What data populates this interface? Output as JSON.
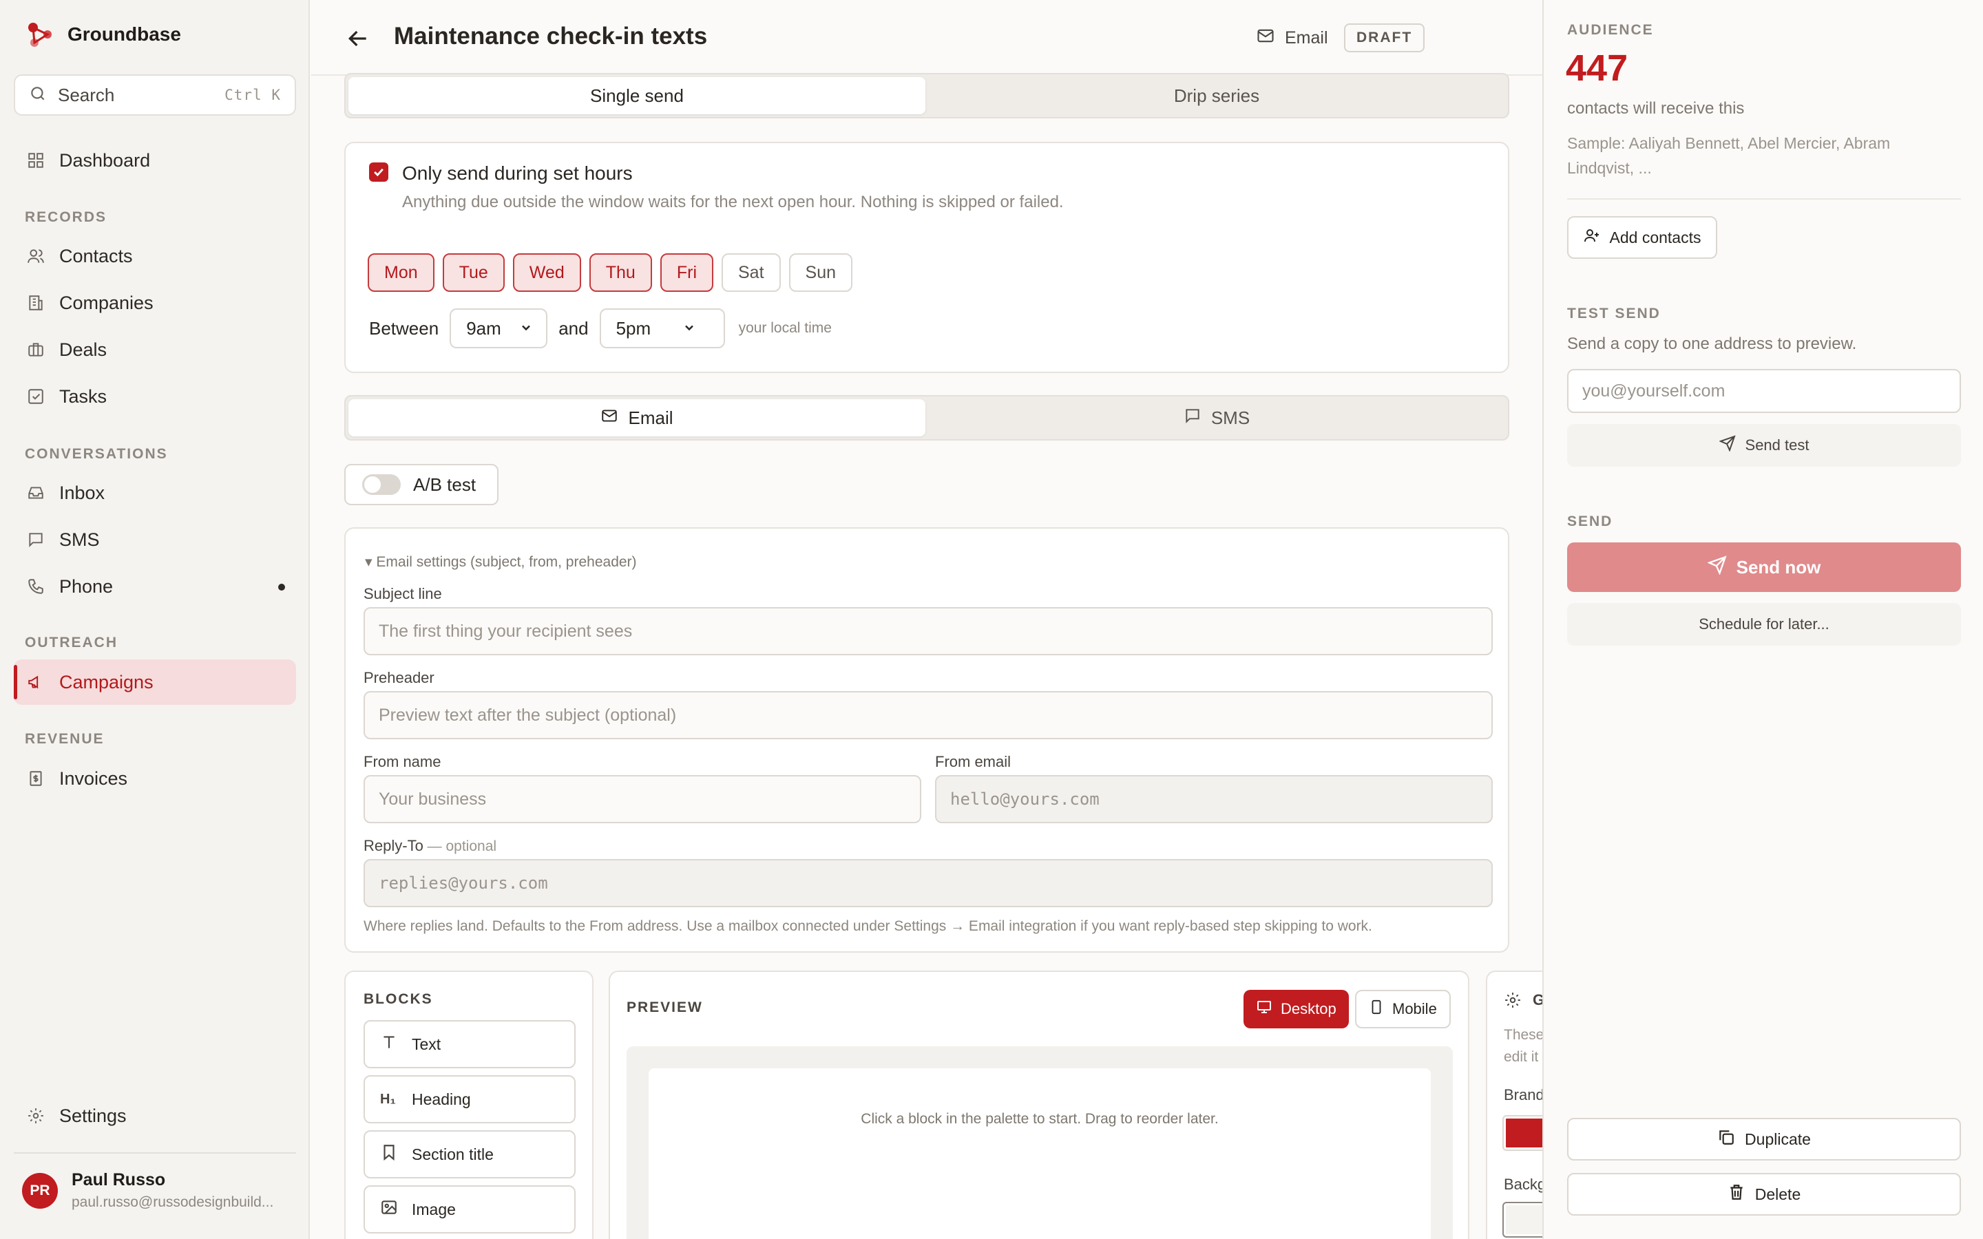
{
  "app": {
    "name": "Groundbase",
    "brand_color": "#c11c1f"
  },
  "search": {
    "placeholder": "Search",
    "shortcut": "Ctrl K"
  },
  "sidebar": {
    "dashboard": "Dashboard",
    "sections": {
      "records": "RECORDS",
      "conversations": "CONVERSATIONS",
      "outreach": "OUTREACH",
      "revenue": "REVENUE"
    },
    "items": {
      "contacts": "Contacts",
      "companies": "Companies",
      "deals": "Deals",
      "tasks": "Tasks",
      "inbox": "Inbox",
      "sms": "SMS",
      "phone": "Phone",
      "campaigns": "Campaigns",
      "invoices": "Invoices"
    },
    "settings": "Settings",
    "user": {
      "initials": "PR",
      "name": "Paul Russo",
      "email": "paul.russo@russodesignbuild..."
    }
  },
  "header": {
    "title": "Maintenance check-in texts",
    "channel": "Email",
    "status": "DRAFT"
  },
  "send_mode": {
    "single": "Single send",
    "drip": "Drip series"
  },
  "hours": {
    "title": "Only send during set hours",
    "help": "Anything due outside the window waits for the next open hour. Nothing is skipped or failed.",
    "days": [
      {
        "label": "Mon",
        "on": true
      },
      {
        "label": "Tue",
        "on": true
      },
      {
        "label": "Wed",
        "on": true
      },
      {
        "label": "Thu",
        "on": true
      },
      {
        "label": "Fri",
        "on": true
      },
      {
        "label": "Sat",
        "on": false
      },
      {
        "label": "Sun",
        "on": false
      }
    ],
    "between": "Between",
    "start": "9am",
    "and": "and",
    "end": "5pm",
    "tz_note": "your local time"
  },
  "channel_tabs": {
    "email": "Email",
    "sms": "SMS"
  },
  "ab_test": {
    "label": "A/B test"
  },
  "email_settings": {
    "summary": "Email settings (subject, from, preheader)",
    "subject_label": "Subject line",
    "subject_placeholder": "The first thing your recipient sees",
    "preheader_label": "Preheader",
    "preheader_placeholder": "Preview text after the subject (optional)",
    "from_name_label": "From name",
    "from_name_placeholder": "Your business",
    "from_email_label": "From email",
    "from_email_placeholder": "hello@yours.com",
    "reply_to_label": "Reply-To",
    "reply_to_optional": " — optional",
    "reply_to_placeholder": "replies@yours.com",
    "reply_to_help": "Where replies land. Defaults to the From address. Use a mailbox connected under Settings → Email integration if you want reply-based step skipping to work."
  },
  "blocks": {
    "title": "BLOCKS",
    "items": [
      "Text",
      "Heading",
      "Section title",
      "Image"
    ]
  },
  "preview": {
    "title": "PREVIEW",
    "desktop": "Desktop",
    "mobile": "Mobile",
    "hint": "Click a block in the palette to start. Drag to reorder later."
  },
  "global_settings": {
    "title_fragment": "G",
    "desc_line1": "These",
    "desc_line2": "edit it",
    "brand_label": "Brand",
    "background_label": "Backg",
    "brand_color": "#c11c1f"
  },
  "audience": {
    "label": "AUDIENCE",
    "count": "447",
    "caption": "contacts will receive this",
    "sample": "Sample: Aaliyah Bennett, Abel Mercier, Abram Lindqvist, ...",
    "add_contacts": "Add contacts"
  },
  "test_send": {
    "label": "TEST SEND",
    "caption": "Send a copy to one address to preview.",
    "placeholder": "you@yourself.com",
    "button": "Send test"
  },
  "send": {
    "label": "SEND",
    "send_now": "Send now",
    "schedule": "Schedule for later..."
  },
  "actions": {
    "duplicate": "Duplicate",
    "delete": "Delete"
  }
}
